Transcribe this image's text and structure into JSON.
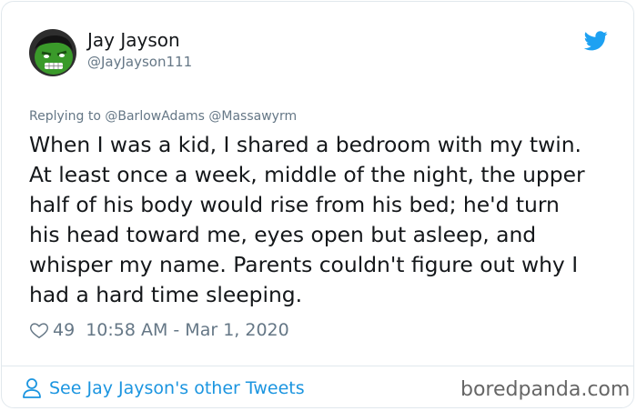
{
  "author": {
    "name": "Jay Jayson",
    "handle": "@JayJayson111"
  },
  "tweet": {
    "replying_to": "Replying to @BarlowAdams @Massawyrm",
    "text_lines": [
      "When I was a kid, I shared a bedroom with my twin.",
      "At least once a week, middle of the night, the upper",
      "half of his body would rise from his bed; he'd turn",
      "his head toward me, eyes open but asleep, and",
      "whisper my name. Parents couldn't figure out why I",
      "had a hard time sleeping."
    ],
    "likes": "49",
    "timestamp": "10:58 AM - Mar 1, 2020"
  },
  "footer": {
    "other_tweets_link": "See Jay Jayson's other Tweets",
    "watermark": "boredpanda.com"
  },
  "icons": {
    "brand": "twitter-bird-icon",
    "like": "heart-icon",
    "profile": "person-icon"
  },
  "colors": {
    "twitter_blue": "#1da1f2",
    "link_blue": "#1b95e0",
    "secondary_text": "#657786",
    "primary_text": "#14171a",
    "border": "#e1e8ed",
    "avatar_green": "#3a9a2a"
  }
}
